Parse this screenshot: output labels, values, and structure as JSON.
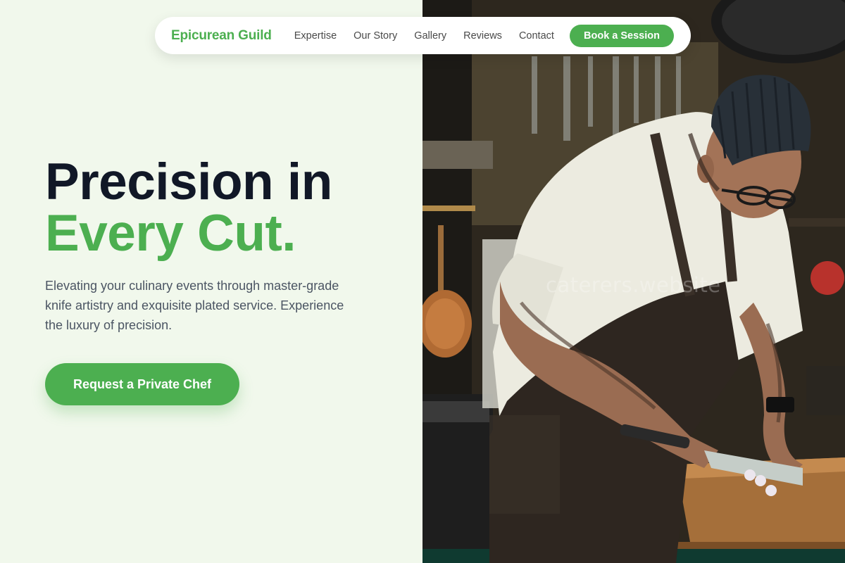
{
  "brand": "Epicurean Guild",
  "nav": {
    "links": [
      "Expertise",
      "Our Story",
      "Gallery",
      "Reviews",
      "Contact"
    ],
    "cta": "Book a Session"
  },
  "hero": {
    "title_line1": "Precision in",
    "title_line2": "Every Cut.",
    "description": "Elevating your culinary events through master-grade knife artistry and exquisite plated service. Experience the luxury of precision.",
    "cta": "Request a Private Chef"
  },
  "photo": {
    "watermark": "caterers.website"
  },
  "colors": {
    "accent": "#4caf50",
    "heading": "#111827",
    "body_text": "#4b5563",
    "left_background": "#f1f8ec"
  }
}
